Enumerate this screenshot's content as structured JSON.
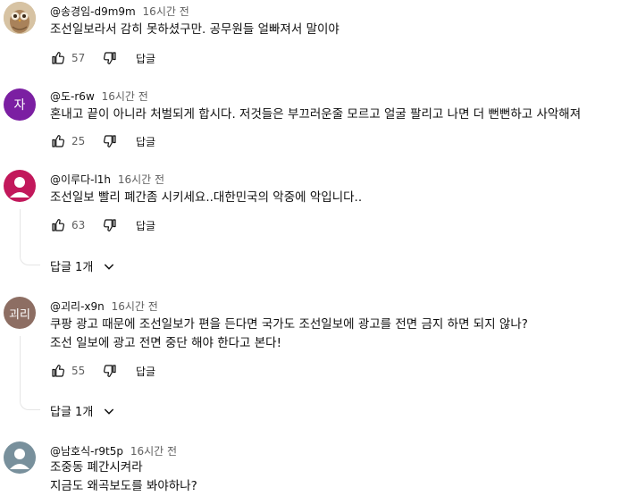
{
  "comments": [
    {
      "author": "@송경임-d9m9m",
      "time": "16시간 전",
      "lines": [
        "조선일보라서 감히 못하셨구만. 공무원들 얼빠져서 말이야"
      ],
      "likes": "57",
      "reply_label": "답글",
      "avatar": {
        "type": "image",
        "bg": "#b89a78"
      }
    },
    {
      "author": "@도-r6w",
      "time": "16시간 전",
      "lines": [
        "혼내고 끝이 아니라 처벌되게 합시다. 저것들은 부끄러운줄 모르고 얼굴 팔리고 나면 더 뻔뻔하고 사악해져"
      ],
      "likes": "25",
      "reply_label": "답글",
      "avatar": {
        "type": "letter",
        "letter": "자",
        "bg": "#7b1fa2"
      }
    },
    {
      "author": "@이루다-l1h",
      "time": "16시간 전",
      "lines": [
        "조선일보 빨리 폐간좀 시키세요..대한민국의 악중에 악입니다.."
      ],
      "likes": "63",
      "reply_label": "답글",
      "replies_label": "답글 1개",
      "avatar": {
        "type": "person",
        "bg": "#c2185b"
      }
    },
    {
      "author": "@괴리-x9n",
      "time": "16시간 전",
      "lines": [
        "쿠팡 광고 때문에 조선일보가 편을 든다면 국가도 조선일보에 광고를 전면 금지 하면 되지 않나?",
        "조선 일보에 광고 전면 중단 해야 한다고 본다!"
      ],
      "likes": "55",
      "reply_label": "답글",
      "replies_label": "답글 1개",
      "avatar": {
        "type": "letter",
        "letter": "괴리",
        "bg": "#8d6e63"
      }
    },
    {
      "author": "@남호식-r9t5p",
      "time": "16시간 전",
      "lines": [
        "조중동 폐간시켜라",
        "지금도 왜곡보도를 봐야하나?"
      ],
      "avatar": {
        "type": "person",
        "bg": "#78909c"
      }
    }
  ]
}
